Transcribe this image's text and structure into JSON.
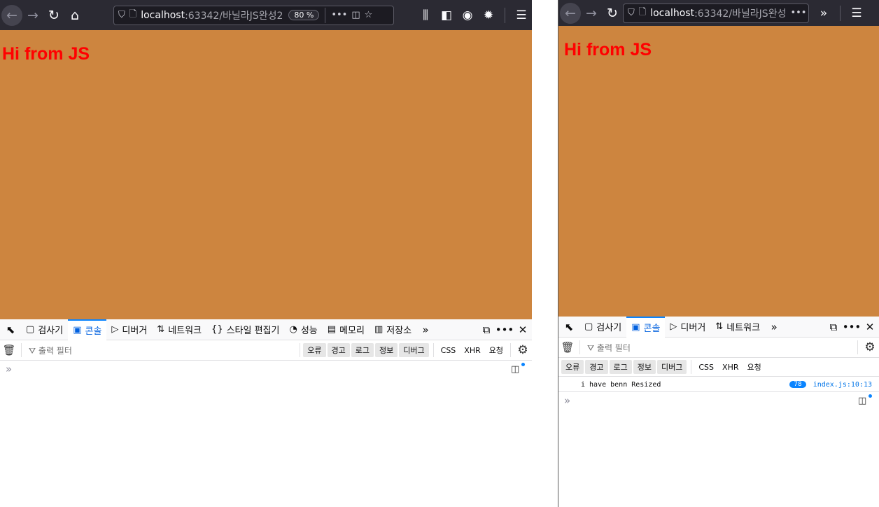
{
  "left_window": {
    "nav": {
      "back_icon": "arrow-left",
      "forward_icon": "arrow-right",
      "reload_icon": "reload",
      "home_icon": "home",
      "url_host": "localhost",
      "url_path": ":63342/바닐라JS완성2",
      "zoom": "80 %"
    },
    "page": {
      "heading": "Hi from JS",
      "background": "#cd853f",
      "heading_color": "#ff0000"
    },
    "devtools": {
      "tabs": [
        "검사기",
        "콘솔",
        "디버거",
        "네트워크",
        "스타일 편집기",
        "성능",
        "메모리",
        "저장소"
      ],
      "filter_placeholder": "출력 필터",
      "chips": [
        "오류",
        "경고",
        "로그",
        "정보",
        "디버그"
      ],
      "plain_filters": [
        "CSS",
        "XHR",
        "요청"
      ]
    }
  },
  "right_window": {
    "nav": {
      "url_host": "localhost",
      "url_path": ":63342/바닐라JS완성"
    },
    "page": {
      "heading": "Hi from JS"
    },
    "devtools": {
      "tabs": [
        "검사기",
        "콘솔",
        "디버거",
        "네트워크"
      ],
      "filter_placeholder": "출력 필터",
      "chips": [
        "오류",
        "경고",
        "로그",
        "정보",
        "디버그"
      ],
      "plain_filters": [
        "CSS",
        "XHR",
        "요청"
      ],
      "log": {
        "message": "i have benn Resized",
        "count": "78",
        "location": "index.js:10:13"
      }
    }
  }
}
